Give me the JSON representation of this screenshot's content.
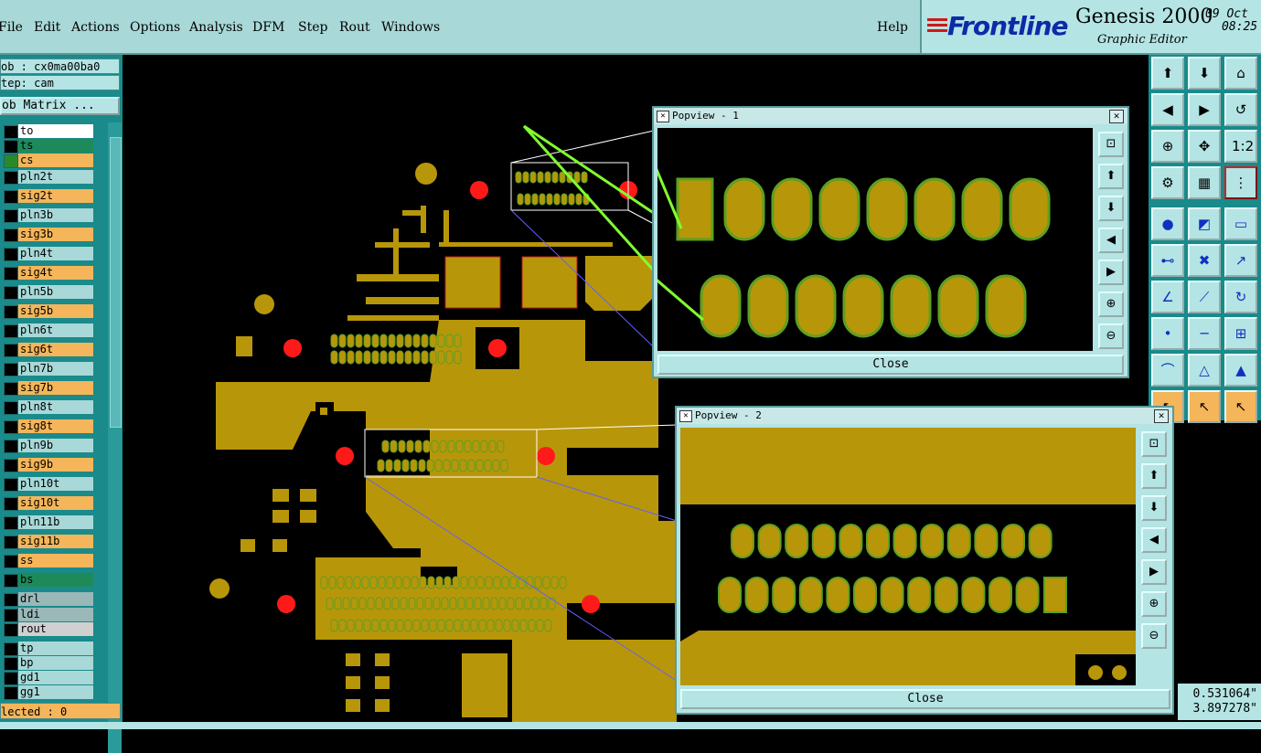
{
  "menu": [
    "File",
    "Edit",
    "Actions",
    "Options",
    "Analysis",
    "DFM",
    "Step",
    "Rout",
    "Windows"
  ],
  "help": "Help",
  "logo": {
    "brand": "Frontline",
    "product": "Genesis 2000",
    "subtitle": "Graphic Editor",
    "date": "09 Oct",
    "time": "08:25"
  },
  "job": "ob : cx0ma00ba0",
  "step": "tep: cam",
  "job_matrix": "ob Matrix ...",
  "layers": [
    {
      "name": "to",
      "color": "#ffffff",
      "sq": "#000000"
    },
    {
      "name": "ts",
      "color": "#1e8a5a",
      "sq": "#000000"
    },
    {
      "name": "cs",
      "color": "#f5b55a",
      "sq": "#2a8a2a"
    },
    {
      "name": "pln2t",
      "color": "#a8d8d8",
      "sq": "#000000"
    },
    {
      "name": "sig2t",
      "color": "#f5b55a",
      "sq": "#000000"
    },
    {
      "name": "pln3b",
      "color": "#a8d8d8",
      "sq": "#000000"
    },
    {
      "name": "sig3b",
      "color": "#f5b55a",
      "sq": "#000000"
    },
    {
      "name": "pln4t",
      "color": "#a8d8d8",
      "sq": "#000000"
    },
    {
      "name": "sig4t",
      "color": "#f5b55a",
      "sq": "#000000"
    },
    {
      "name": "pln5b",
      "color": "#a8d8d8",
      "sq": "#000000"
    },
    {
      "name": "sig5b",
      "color": "#f5b55a",
      "sq": "#000000"
    },
    {
      "name": "pln6t",
      "color": "#a8d8d8",
      "sq": "#000000"
    },
    {
      "name": "sig6t",
      "color": "#f5b55a",
      "sq": "#000000"
    },
    {
      "name": "pln7b",
      "color": "#a8d8d8",
      "sq": "#000000"
    },
    {
      "name": "sig7b",
      "color": "#f5b55a",
      "sq": "#000000"
    },
    {
      "name": "pln8t",
      "color": "#a8d8d8",
      "sq": "#000000"
    },
    {
      "name": "sig8t",
      "color": "#f5b55a",
      "sq": "#000000"
    },
    {
      "name": "pln9b",
      "color": "#a8d8d8",
      "sq": "#000000"
    },
    {
      "name": "sig9b",
      "color": "#f5b55a",
      "sq": "#000000"
    },
    {
      "name": "pln10t",
      "color": "#a8d8d8",
      "sq": "#000000"
    },
    {
      "name": "sig10t",
      "color": "#f5b55a",
      "sq": "#000000"
    },
    {
      "name": "pln11b",
      "color": "#a8d8d8",
      "sq": "#000000"
    },
    {
      "name": "sig11b",
      "color": "#f5b55a",
      "sq": "#000000"
    },
    {
      "name": "ss",
      "color": "#f5b55a",
      "sq": "#000000"
    },
    {
      "name": "bs",
      "color": "#1e8a5a",
      "sq": "#000000"
    },
    {
      "name": "drl",
      "color": "#9ab8b8",
      "sq": "#000000"
    },
    {
      "name": "ldi",
      "color": "#9ab8b8",
      "sq": "#000000"
    },
    {
      "name": "rout",
      "color": "#d0d0d0",
      "sq": "#000000"
    },
    {
      "name": "tp",
      "color": "#a8d8d8",
      "sq": "#000000"
    },
    {
      "name": "bp",
      "color": "#a8d8d8",
      "sq": "#000000"
    },
    {
      "name": "gd1",
      "color": "#a8d8d8",
      "sq": "#000000"
    },
    {
      "name": "gg1",
      "color": "#a8d8d8",
      "sq": "#000000"
    }
  ],
  "selected": "lected : 0",
  "popview1": {
    "title": "Popview - 1",
    "close": "Close"
  },
  "popview2": {
    "title": "Popview - 2",
    "close": "Close"
  },
  "coords": {
    "x": "0.531064\"",
    "y": "3.897278\""
  },
  "colors": {
    "copper": "#b8960a",
    "pad_edge": "#5ea020",
    "drill": "#ff1a1a",
    "panel": "#b4e4e4"
  }
}
